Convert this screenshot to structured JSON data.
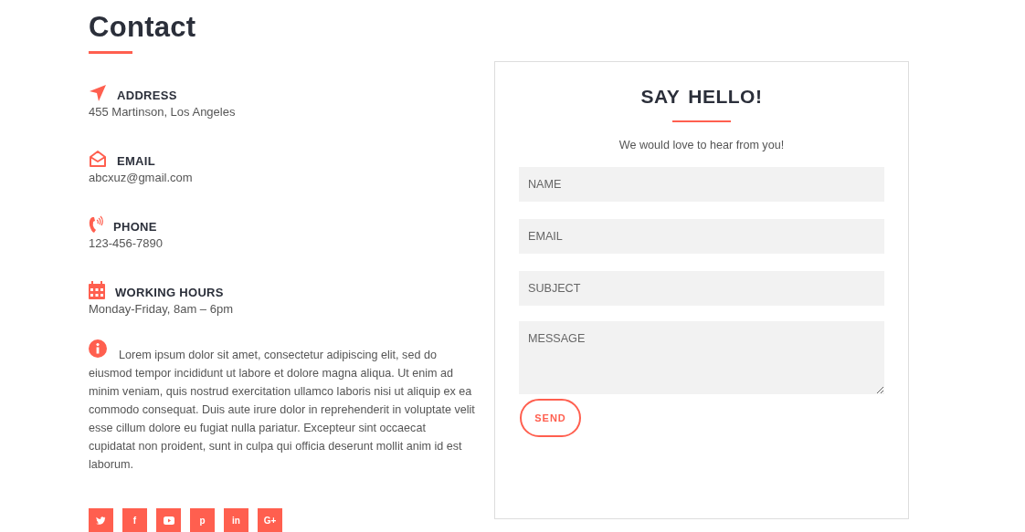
{
  "contact": {
    "title": "Contact",
    "items": [
      {
        "kind": "address",
        "label": "ADDRESS",
        "value": "455 Martinson, Los Angeles"
      },
      {
        "kind": "email",
        "label": "EMAIL",
        "value": "abcxuz@gmail.com"
      },
      {
        "kind": "phone",
        "label": "PHONE",
        "value": "123-456-7890"
      },
      {
        "kind": "hours",
        "label": "WORKING HOURS",
        "value": "Monday-Friday, 8am – 6pm"
      }
    ],
    "about": "Lorem ipsum dolor sit amet, consectetur adipiscing elit, sed do eiusmod tempor incididunt ut labore et dolore magna aliqua. Ut enim ad minim veniam, quis nostrud exercitation ullamco laboris nisi ut aliquip ex ea commodo consequat. Duis aute irure dolor in reprehenderit in voluptate velit esse cillum dolore eu fugiat nulla pariatur. Excepteur sint occaecat cupidatat non proident, sunt in culpa qui officia deserunt mollit anim id est laborum.",
    "social": [
      {
        "kind": "bird"
      },
      {
        "kind": "text",
        "label": "f"
      },
      {
        "kind": "play"
      },
      {
        "kind": "text",
        "label": "p"
      },
      {
        "kind": "text",
        "label": "in"
      },
      {
        "kind": "text",
        "label": "G+"
      }
    ]
  },
  "form": {
    "title": "SAY HELLO!",
    "subtitle": "We would love to hear from you!",
    "fields": [
      {
        "kind": "line",
        "placeholder": "NAME"
      },
      {
        "kind": "line",
        "placeholder": "EMAIL"
      },
      {
        "kind": "line",
        "placeholder": "SUBJECT"
      },
      {
        "kind": "area",
        "placeholder": "MESSAGE"
      }
    ],
    "button": "SEND"
  }
}
